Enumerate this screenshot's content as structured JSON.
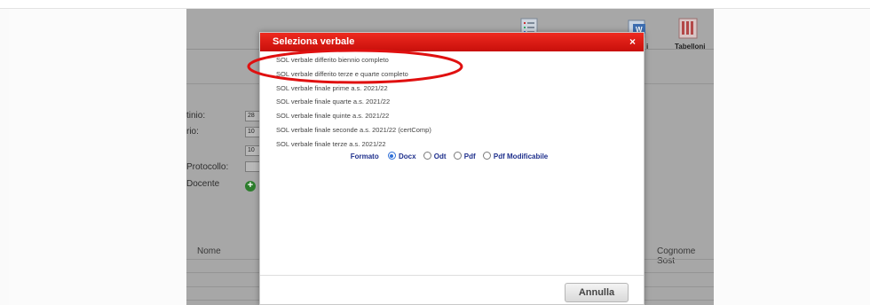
{
  "background": {
    "toolbar": {
      "label_1": "i",
      "label_2": "Tabelloni"
    },
    "form": {
      "labels": [
        "tinio:",
        "rio:",
        "Protocollo:",
        "Docente"
      ],
      "box_values": [
        "28",
        "10",
        "10"
      ],
      "add_symbol": "+"
    },
    "table": {
      "col_nome": "Nome",
      "col_cognome_sost": "Cognome Sost"
    }
  },
  "dialog": {
    "title": "Seleziona verbale",
    "close": "×",
    "items": [
      "SOL verbale differito biennio completo",
      "SOL verbale differito terze e quarte completo",
      "SOL verbale finale prime a.s. 2021/22",
      "SOL verbale finale quarte a.s. 2021/22",
      "SOL verbale finale quinte a.s. 2021/22",
      "SOL verbale finale seconde a.s. 2021/22 (certComp)",
      "SOL verbale finale terze a.s. 2021/22"
    ],
    "format": {
      "label": "Formato",
      "selected": "Docx",
      "options": [
        "Docx",
        "Odt",
        "Pdf",
        "Pdf Modificabile"
      ]
    },
    "cancel_label": "Annulla"
  },
  "colors": {
    "header_red": "#e01a14",
    "annotation_red": "#e01010",
    "format_text": "#1e2f8c",
    "radio_selected": "#2f6fd8"
  }
}
